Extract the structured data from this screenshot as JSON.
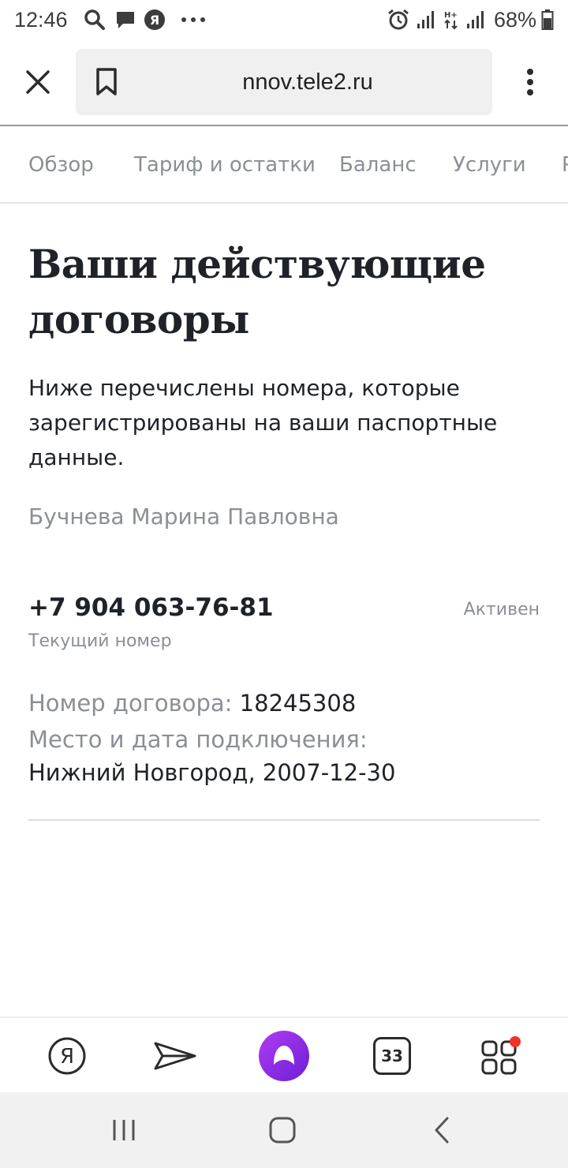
{
  "status_bar": {
    "time": "12:46",
    "battery": "68%",
    "icons": [
      "search-icon",
      "chat-icon",
      "yandex-icon",
      "more-icon",
      "alarm-icon",
      "signal-icon",
      "network-hplus-icon",
      "signal-icon",
      "battery-icon"
    ]
  },
  "browser": {
    "url": "nnov.tele2.ru"
  },
  "tabs": [
    "Обзор",
    "Тариф и остатки",
    "Баланс",
    "Услуги",
    "Р"
  ],
  "page": {
    "title": "Ваши действующие договоры",
    "description": "Ниже перечислены номера, которые зарегистрированы на ваши паспортные данные.",
    "owner": "Бучнева Марина Павловна"
  },
  "contract": {
    "phone": "+7 904 063-76-81",
    "status": "Активен",
    "current_label": "Текущий номер",
    "number_label": "Номер договора:",
    "number_value": "18245308",
    "place_label": "Место и дата подключения:",
    "place_value": "Нижний Новгород, 2007-12-30"
  },
  "bottom_bar": {
    "tab_count": "33",
    "accent_color": "#8a2be2",
    "notification_color": "#f0322a"
  }
}
